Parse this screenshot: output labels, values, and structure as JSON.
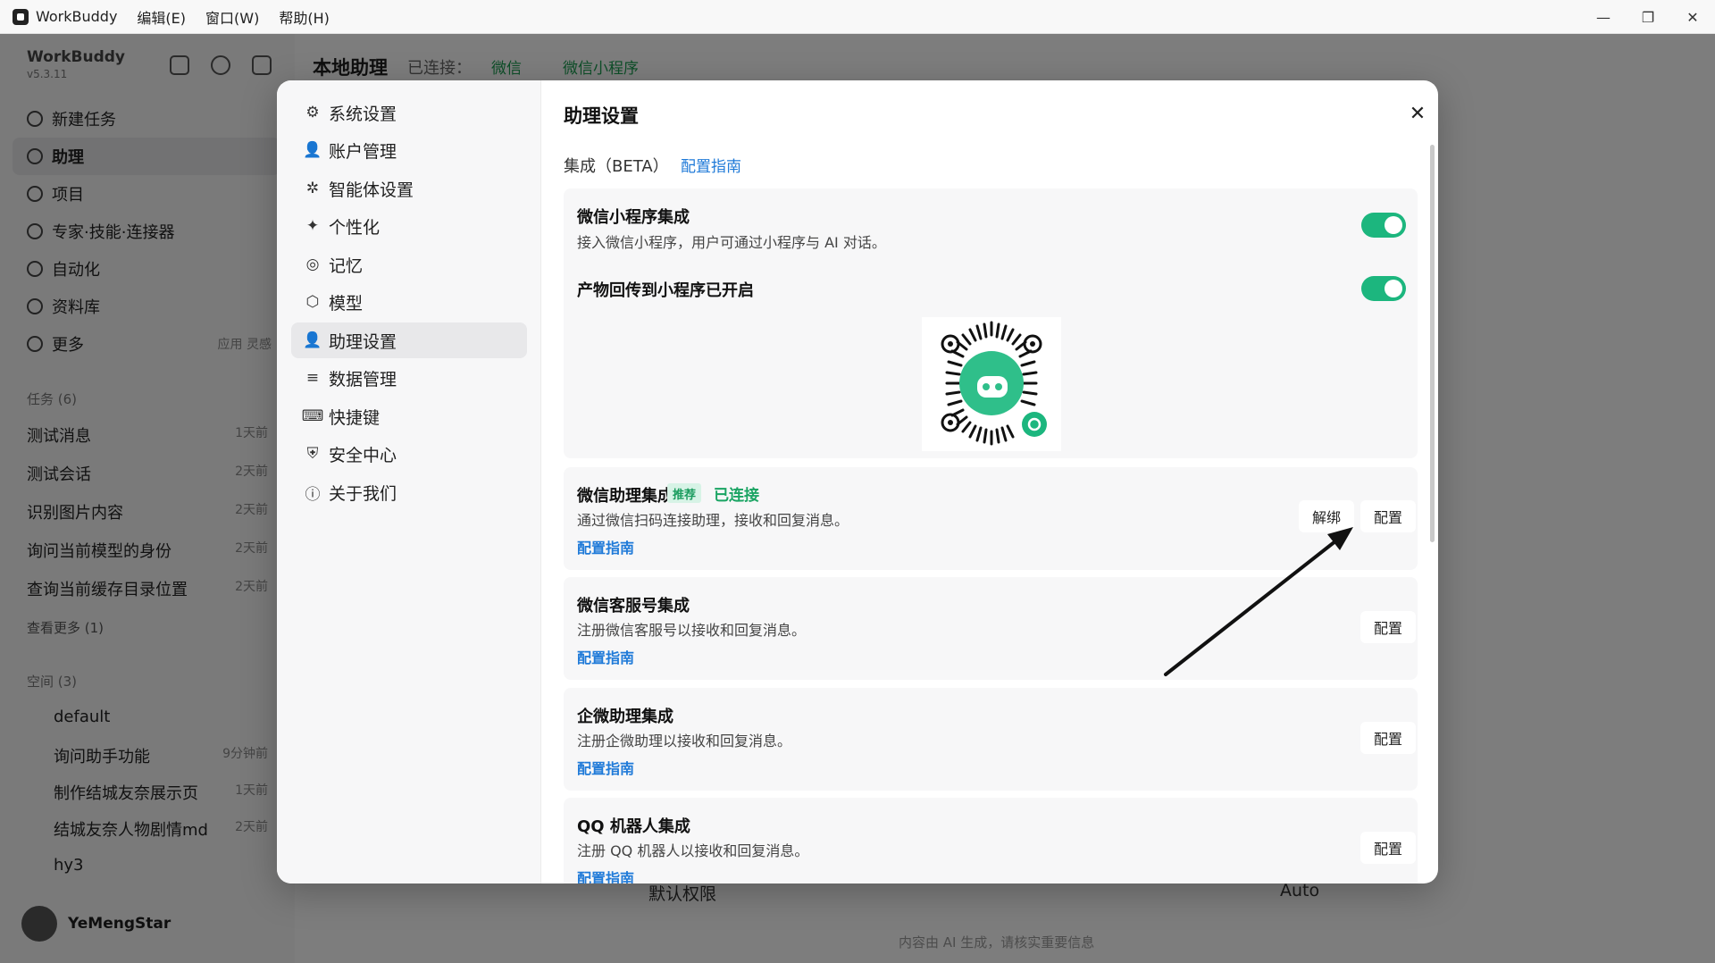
{
  "titlebar": {
    "app_name": "WorkBuddy",
    "menus": [
      "编辑(E)",
      "窗口(W)",
      "帮助(H)"
    ],
    "window_buttons": [
      "—",
      "❐",
      "✕"
    ]
  },
  "sidebar": {
    "brand": "WorkBuddy",
    "version": "v5.3.11",
    "nav": [
      {
        "label": "新建任务",
        "icon": "plus-circle-icon"
      },
      {
        "label": "助理",
        "icon": "assistant-icon",
        "active": true
      },
      {
        "label": "项目",
        "icon": "project-icon"
      },
      {
        "label": "专家·技能·连接器",
        "icon": "expert-icon"
      },
      {
        "label": "自动化",
        "icon": "automation-icon"
      },
      {
        "label": "资料库",
        "icon": "library-icon"
      },
      {
        "label": "更多",
        "icon": "more-icon",
        "extra": "应用 灵感"
      }
    ],
    "tasks_header": "任务 (6)",
    "tasks": [
      {
        "title": "测试消息",
        "time": "1天前"
      },
      {
        "title": "测试会话",
        "time": "2天前"
      },
      {
        "title": "识别图片内容",
        "time": "2天前"
      },
      {
        "title": "询问当前模型的身份",
        "time": "2天前"
      },
      {
        "title": "查询当前缓存目录位置",
        "time": "2天前"
      }
    ],
    "see_more": "查看更多 (1)",
    "spaces_header": "空间 (3)",
    "space_default": "default",
    "space_items": [
      {
        "title": "询问助手功能",
        "time": "9分钟前"
      },
      {
        "title": "制作结城友奈展示页",
        "time": "1天前"
      },
      {
        "title": "结城友奈人物剧情md",
        "time": "2天前"
      }
    ],
    "space_hy3": "hy3",
    "user": "YeMengStar"
  },
  "main": {
    "title": "本地助理",
    "connected_label": "已连接：",
    "tag_wechat": "微信",
    "tag_miniprogram": "微信小程序",
    "composer_permission": "默认权限",
    "composer_model": "Auto",
    "disclaimer": "内容由 AI 生成，请核实重要信息"
  },
  "modal": {
    "nav": [
      {
        "label": "系统设置",
        "icon": "gear-icon",
        "glyph": "⚙"
      },
      {
        "label": "账户管理",
        "icon": "user-icon",
        "glyph": "👤"
      },
      {
        "label": "智能体设置",
        "icon": "agent-icon",
        "glyph": "✲"
      },
      {
        "label": "个性化",
        "icon": "sparkle-icon",
        "glyph": "✦"
      },
      {
        "label": "记忆",
        "icon": "memory-pin-icon",
        "glyph": "◎"
      },
      {
        "label": "模型",
        "icon": "cube-icon",
        "glyph": "⬡"
      },
      {
        "label": "助理设置",
        "icon": "assistant-settings-icon",
        "glyph": "👤",
        "active": true
      },
      {
        "label": "数据管理",
        "icon": "database-icon",
        "glyph": "≡"
      },
      {
        "label": "快捷键",
        "icon": "keyboard-icon",
        "glyph": "⌨"
      },
      {
        "label": "安全中心",
        "icon": "shield-icon",
        "glyph": "⛨"
      },
      {
        "label": "关于我们",
        "icon": "info-icon",
        "glyph": "ⓘ"
      }
    ],
    "title": "助理设置",
    "close_glyph": "✕",
    "section_label": "集成（BETA）",
    "section_link": "配置指南",
    "mini_program": {
      "title": "微信小程序集成",
      "desc": "接入微信小程序，用户可通过小程序与 AI 对话。",
      "toggle_on": true,
      "sub_title": "产物回传到小程序已开启",
      "sub_toggle_on": true
    },
    "wechat_assistant": {
      "title": "微信助理集成",
      "badge": "推荐",
      "status": "已连接",
      "desc": "通过微信扫码连接助理，接收和回复消息。",
      "link": "配置指南",
      "unbind": "解绑",
      "config": "配置"
    },
    "wechat_service": {
      "title": "微信客服号集成",
      "desc": "注册微信客服号以接收和回复消息。",
      "link": "配置指南",
      "config": "配置"
    },
    "wecom": {
      "title": "企微助理集成",
      "desc": "注册企微助理以接收和回复消息。",
      "link": "配置指南",
      "config": "配置"
    },
    "qq_bot": {
      "title": "QQ 机器人集成",
      "desc": "注册 QQ 机器人以接收和回复消息。",
      "link": "配置指南",
      "config": "配置"
    }
  },
  "colors": {
    "accent_green": "#1cb67e",
    "link_blue": "#1f7ad8",
    "overlay": "rgba(0,0,0,0.5)"
  }
}
